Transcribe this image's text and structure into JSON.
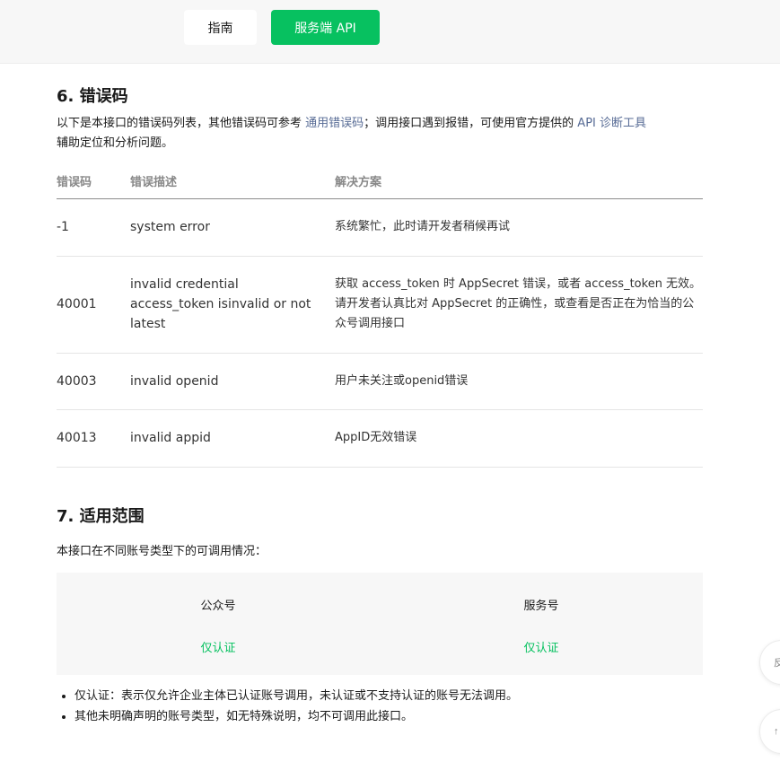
{
  "nav": {
    "tabs": [
      {
        "label": "指南",
        "active": false
      },
      {
        "label": "服务端 API",
        "active": true
      }
    ]
  },
  "colors": {
    "brand_green": "#07c160",
    "link": "#576b95"
  },
  "error_section": {
    "title": "6. 错误码",
    "intro_before": "以下是本接口的错误码列表，其他错误码可参考 ",
    "intro_link1": "通用错误码",
    "intro_middle": "；调用接口遇到报错，可使用官方提供的 ",
    "intro_link2": "API 诊断工具",
    "intro_after": "辅助定位和分析问题。",
    "columns": [
      "错误码",
      "错误描述",
      "解决方案"
    ],
    "rows": [
      {
        "code": "-1",
        "desc": "system error",
        "solution": "系统繁忙，此时请开发者稍候再试"
      },
      {
        "code": "40001",
        "desc": "invalid credential access_token isinvalid or not latest",
        "solution": "获取 access_token 时 AppSecret 错误，或者 access_token 无效。请开发者认真比对 AppSecret 的正确性，或查看是否正在为恰当的公众号调用接口"
      },
      {
        "code": "40003",
        "desc": "invalid openid",
        "solution": "用户未关注或openid错误"
      },
      {
        "code": "40013",
        "desc": "invalid appid",
        "solution": "AppID无效错误"
      }
    ]
  },
  "scope_section": {
    "title": "7. 适用范围",
    "intro": "本接口在不同账号类型下的可调用情况：",
    "account_types": [
      {
        "name": "公众号",
        "status": "仅认证"
      },
      {
        "name": "服务号",
        "status": "仅认证"
      }
    ],
    "notes": [
      "仅认证：表示仅允许企业主体已认证账号调用，未认证或不支持认证的账号无法调用。",
      "其他未明确声明的账号类型，如无特殊说明，均不可调用此接口。"
    ]
  },
  "floating": {
    "feedback_partial": "反",
    "top_partial": "↑"
  }
}
